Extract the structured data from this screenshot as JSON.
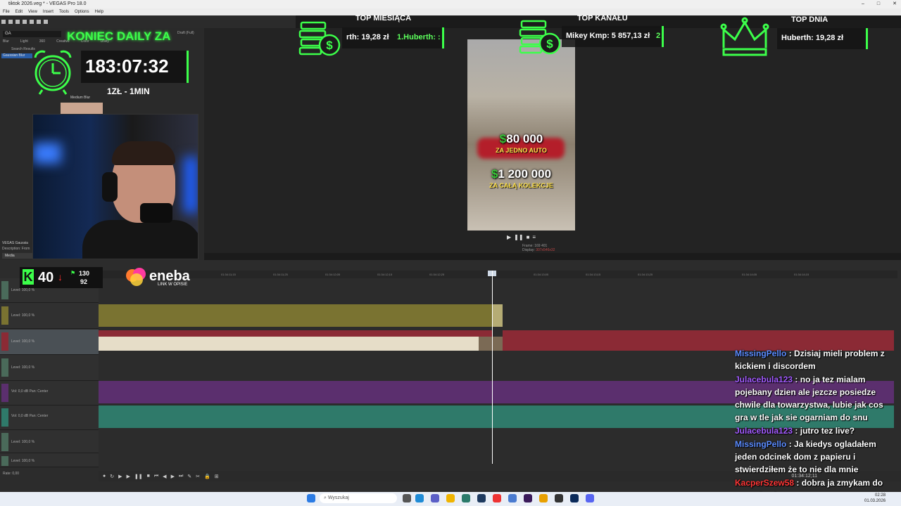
{
  "window": {
    "title": "tiktok 2026.veg * - VEGAS Pro 18.0",
    "controls": [
      "–",
      "□",
      "✕"
    ]
  },
  "menu": [
    "File",
    "Edit",
    "View",
    "Insert",
    "Tools",
    "Options",
    "Help"
  ],
  "fx_panel": {
    "search_value": "GA",
    "tabs": [
      "Blur",
      "Light",
      "360",
      "Creative",
      "Color",
      "Utility"
    ],
    "search_results_label": "Search Results",
    "selected_item": "Gaussian Blur",
    "preset": "Medium Blur",
    "description_title": "VEGAS Gaussia",
    "description_label": "Description: From",
    "media_tab": "Media"
  },
  "preview": {
    "quality": "Draft (Full)",
    "frame_label": "Frame:",
    "frame_value": "169 401",
    "display_label": "Display:",
    "display_value": "307x546x32"
  },
  "video_overlay": {
    "price1": "80 000",
    "caption1": "ZA JEDNO AUTO",
    "price2": "1 200 000",
    "caption2": "ZA CAŁĄ KOLEKCJE",
    "currency": "$"
  },
  "stream_overlay": {
    "daily_title": "KONIEC DAILY ZA",
    "timer": "183:07:32",
    "rate": "1ZŁ - 1MIN",
    "top_month_label": "TOP MIESIĄCA",
    "top_month_text_a": "rth: 19,28 zł",
    "top_month_text_b": "1.Huberth: :",
    "top_channel_label": "TOP KANAŁU",
    "top_channel_text": "Mikey Kmp: 5 857,13 zł",
    "top_channel_suffix": "2",
    "top_day_label": "TOP DNIA",
    "top_day_text": "Huberth: 19,28 zł",
    "k_value": "40",
    "k_stat1": "130",
    "k_stat2": "92",
    "eneba_brand": "eneba",
    "eneba_sub": "LINK W OPISIE"
  },
  "tracks": [
    {
      "label": "Level: 100,0 %"
    },
    {
      "label": "Level: 100,0 %"
    },
    {
      "label": "Level: 100,0 %"
    },
    {
      "label": "Level: 100,0 %"
    },
    {
      "label": "Vol:",
      "val": "0,0 dB",
      "pan_label": "Pan:",
      "pan": "Center"
    },
    {
      "label": "Vol:",
      "val": "0,0 dB",
      "pan_label": "Pan:",
      "pan": "Center"
    },
    {
      "label": "Level: 100,0 %"
    },
    {
      "label": "Level: 100,0 %"
    }
  ],
  "ruler_ticks": [
    "01:34:11;15",
    "01:34:11;25",
    "01:34:12;05",
    "01:34:12;15",
    "01:34:12;25",
    "01:34:13;05",
    "01:34:13;15",
    "01:34:13;25",
    "01:34:14;05",
    "01:34:14;15"
  ],
  "transport": {
    "rate": "Rate: 0,00",
    "timecode": "01:34:12;11"
  },
  "chat": [
    {
      "user": "MissingPello",
      "color": "blue",
      "text": ": Dzisiaj mieli problem z kickiem i discordem"
    },
    {
      "user": "Julacebula123",
      "color": "purple",
      "text": ": no ja tez mialam pojebany dzien ale jezcze posiedze chwile dla towarzystwa, lubie jak cos gra w tle jak sie ogarniam do snu"
    },
    {
      "user": "Julacebula123",
      "color": "purple",
      "text": ": jutro tez live?"
    },
    {
      "user": "MissingPello",
      "color": "blue",
      "text": ": Ja kiedys ogladałem jeden odcinek dom z papieru i stwierdziłem że to nie dla mnie"
    },
    {
      "user": "KacperSzew58",
      "color": "red",
      "text": ": dobra ja zmykam do rana siemka"
    }
  ],
  "taskbar": {
    "search_placeholder": "Wyszukaj",
    "time": "02:28",
    "date": "01.03.2026"
  },
  "colors": {
    "accent_green": "#3cff4a",
    "clip_olive": "#7a7331",
    "clip_red": "#8b2a35",
    "clip_purple": "#5b2f6e",
    "clip_teal": "#2f7a6a",
    "chat_blue": "#5b8cff",
    "chat_purple": "#a35bff"
  }
}
